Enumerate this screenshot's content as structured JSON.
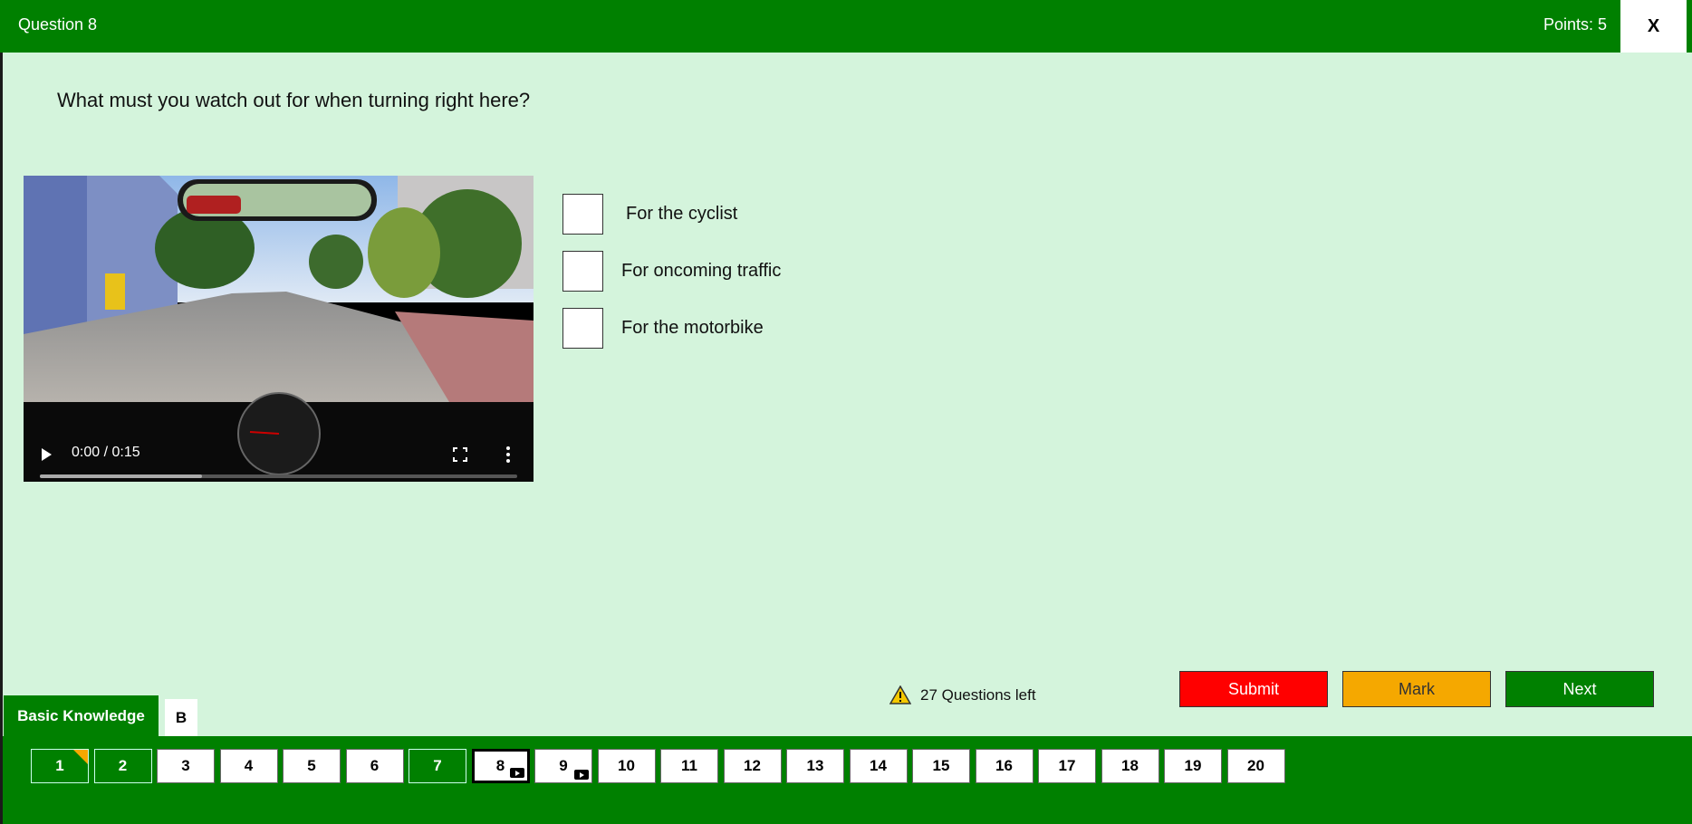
{
  "header": {
    "title": "Question 8",
    "points": "Points: 5",
    "close_label": "X"
  },
  "question": {
    "text": "What must you watch out for when turning right here?"
  },
  "video": {
    "time": "0:00 / 0:15",
    "buffered_fraction": 0.34
  },
  "answers": [
    {
      "label": "For the cyclist"
    },
    {
      "label": "For oncoming traffic"
    },
    {
      "label": "For the motorbike"
    }
  ],
  "status": {
    "questions_left": "27 Questions left",
    "icon": "warning-icon"
  },
  "buttons": {
    "submit": "Submit",
    "mark": "Mark",
    "next": "Next"
  },
  "tabs": {
    "category": "Basic Knowledge",
    "class": "B"
  },
  "colors": {
    "primary": "#008000",
    "background": "#d4f4dc",
    "submit": "#ff0000",
    "mark": "#f5a800"
  },
  "question_nav": [
    {
      "num": "1",
      "state": "answered",
      "marked": true,
      "video": false
    },
    {
      "num": "2",
      "state": "answered",
      "marked": false,
      "video": false
    },
    {
      "num": "3",
      "state": "open",
      "marked": false,
      "video": false
    },
    {
      "num": "4",
      "state": "open",
      "marked": false,
      "video": false
    },
    {
      "num": "5",
      "state": "open",
      "marked": false,
      "video": false
    },
    {
      "num": "6",
      "state": "open",
      "marked": false,
      "video": false
    },
    {
      "num": "7",
      "state": "answered",
      "marked": false,
      "video": false
    },
    {
      "num": "8",
      "state": "current",
      "marked": false,
      "video": true
    },
    {
      "num": "9",
      "state": "open",
      "marked": false,
      "video": true
    },
    {
      "num": "10",
      "state": "open",
      "marked": false,
      "video": false
    },
    {
      "num": "11",
      "state": "open",
      "marked": false,
      "video": false
    },
    {
      "num": "12",
      "state": "open",
      "marked": false,
      "video": false
    },
    {
      "num": "13",
      "state": "open",
      "marked": false,
      "video": false
    },
    {
      "num": "14",
      "state": "open",
      "marked": false,
      "video": false
    },
    {
      "num": "15",
      "state": "open",
      "marked": false,
      "video": false
    },
    {
      "num": "16",
      "state": "open",
      "marked": false,
      "video": false
    },
    {
      "num": "17",
      "state": "open",
      "marked": false,
      "video": false
    },
    {
      "num": "18",
      "state": "open",
      "marked": false,
      "video": false
    },
    {
      "num": "19",
      "state": "open",
      "marked": false,
      "video": false
    },
    {
      "num": "20",
      "state": "open",
      "marked": false,
      "video": false
    }
  ]
}
